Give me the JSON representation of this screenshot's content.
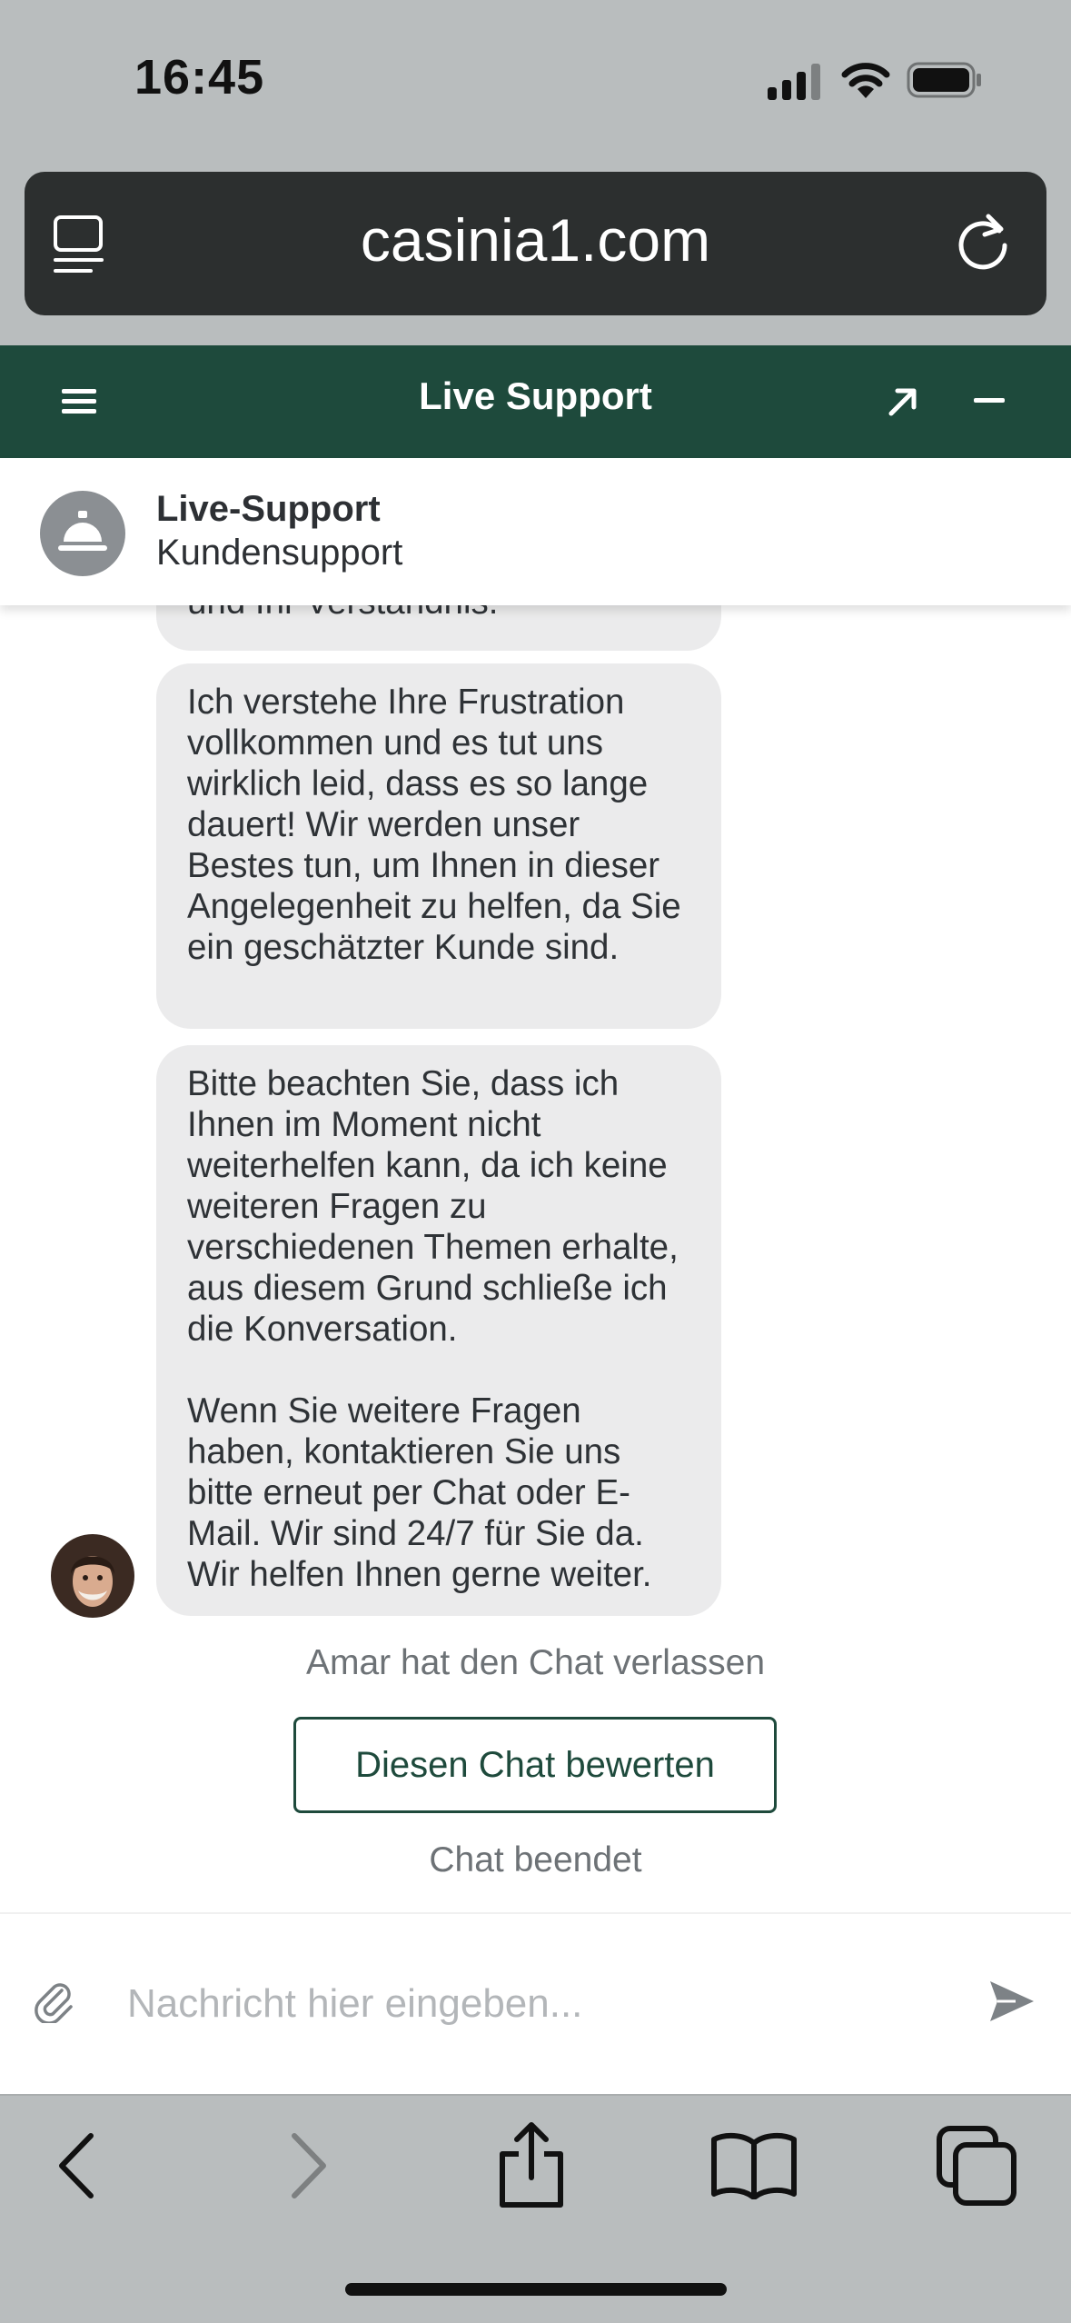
{
  "status_bar": {
    "time": "16:45"
  },
  "browser": {
    "url": "casinia1.com"
  },
  "widget": {
    "title": "Live Support"
  },
  "agent": {
    "name": "Live-Support",
    "subtitle": "Kundensupport"
  },
  "messages": [
    {
      "paragraphs": [
        "und Ihr Verständnis."
      ]
    },
    {
      "paragraphs": [
        "Ich verstehe Ihre Frustration vollkommen und es tut uns wirklich leid, dass es so lange dauert! Wir werden unser Bestes tun, um Ihnen in dieser Angelegenheit zu helfen, da Sie ein geschätzter Kunde sind."
      ]
    },
    {
      "paragraphs": [
        "Bitte beachten Sie, dass ich Ihnen im Moment nicht weiterhelfen kann, da ich keine weiteren Fragen zu verschiedenen Themen erhalte, aus diesem Grund schließe ich die Konversation.",
        "Wenn Sie weitere Fragen haben, kontaktieren Sie uns bitte erneut per Chat oder E-Mail. Wir sind 24/7 für Sie da. Wir helfen Ihnen gerne weiter."
      ]
    }
  ],
  "system": {
    "left_notice": "Amar hat den Chat verlassen",
    "rate_button": "Diesen Chat bewerten",
    "ended": "Chat beendet"
  },
  "composer": {
    "placeholder": "Nachricht hier eingeben..."
  },
  "colors": {
    "header_green": "#1e4a3c",
    "bubble_gray": "#ebebec",
    "chrome_gray": "#b9bdbe"
  },
  "icons": [
    "reader-icon",
    "reload-icon",
    "menu-icon",
    "popout-icon",
    "minimize-icon",
    "concierge-bell-icon",
    "attach-icon",
    "send-icon",
    "back-icon",
    "forward-icon",
    "share-icon",
    "bookmarks-icon",
    "tabs-icon"
  ]
}
